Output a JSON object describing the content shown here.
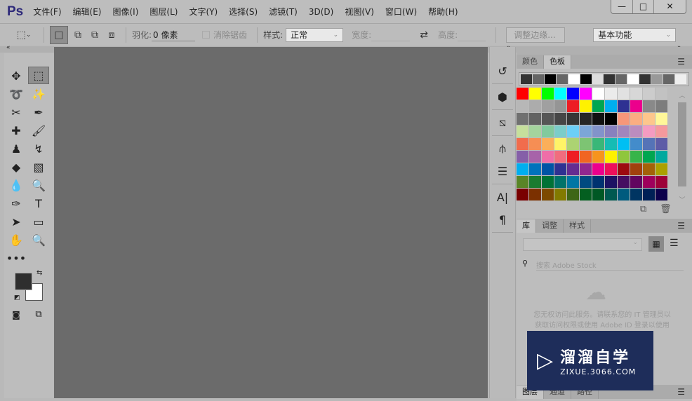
{
  "app": {
    "logo": "Ps"
  },
  "menu": [
    "文件(F)",
    "编辑(E)",
    "图像(I)",
    "图层(L)",
    "文字(Y)",
    "选择(S)",
    "滤镜(T)",
    "3D(D)",
    "视图(V)",
    "窗口(W)",
    "帮助(H)"
  ],
  "window": {
    "minimize": "—",
    "maximize": "□",
    "close": "✕"
  },
  "options": {
    "feather_label": "羽化:",
    "feather_value": "0 像素",
    "antialias": "消除锯齿",
    "style_label": "样式:",
    "style_value": "正常",
    "width_label": "宽度:",
    "height_label": "高度:",
    "refine_edge": "调整边缘...",
    "workspace": "基本功能"
  },
  "swatches_panel": {
    "tabs": [
      "颜色",
      "色板"
    ],
    "active": "色板",
    "recent": [
      "#333333",
      "#666666",
      "#000000",
      "#666666",
      "#ffffff",
      "#000000",
      "#dddddd",
      "#333333",
      "#666666",
      "#ffffff",
      "#333333",
      "#999999",
      "#666666",
      "#eeeeee"
    ],
    "colors": [
      "#ff0000",
      "#ffff00",
      "#00ff00",
      "#00ffff",
      "#0000ff",
      "#ff00ff",
      "#ffffff",
      "#ebebeb",
      "#e1e1e1",
      "#d7d7d7",
      "#cccccc",
      "#c2c2c2",
      "#b7b7b7",
      "#acacac",
      "#a0a0a0",
      "#959595",
      "#ed1c24",
      "#fff200",
      "#00a651",
      "#00aeef",
      "#2e3192",
      "#ec008c",
      "#898989",
      "#7d7d7d",
      "#707070",
      "#626262",
      "#555555",
      "#464646",
      "#363636",
      "#262626",
      "#111111",
      "#000000",
      "#f7977a",
      "#fbad82",
      "#fdc68c",
      "#fff799",
      "#c6df9c",
      "#a4d49d",
      "#81ca9d",
      "#7bcdc9",
      "#6ccff7",
      "#7ca6d8",
      "#8293ca",
      "#8881be",
      "#a286bd",
      "#bc8cbf",
      "#f49bc1",
      "#f5999d",
      "#f16c4d",
      "#f68e54",
      "#fbaf5a",
      "#fff467",
      "#acd372",
      "#7dc473",
      "#39b778",
      "#16bcb4",
      "#00bff3",
      "#438ccb",
      "#5573b7",
      "#5e5ca7",
      "#855fa8",
      "#a763a9",
      "#ef6ea8",
      "#f16d7e",
      "#ee1d24",
      "#f16522",
      "#f7941d",
      "#fff100",
      "#8fc63d",
      "#37b44a",
      "#00a650",
      "#00a99e",
      "#00aeef",
      "#0072bc",
      "#0054a5",
      "#2f3192",
      "#652c91",
      "#91278f",
      "#ed008c",
      "#ee105a",
      "#9d0a0f",
      "#a1410d",
      "#a36209",
      "#aba000",
      "#598527",
      "#1a7b30",
      "#007236",
      "#00736a",
      "#0076a4",
      "#004a80",
      "#003370",
      "#1d1363",
      "#450e61",
      "#62055f",
      "#9e005c",
      "#9d0039",
      "#790000",
      "#7b3000",
      "#7c4900",
      "#827a00",
      "#3e6617",
      "#045f20",
      "#005824",
      "#005951",
      "#005b7e",
      "#003562",
      "#002056",
      "#0c004b"
    ]
  },
  "library_panel": {
    "tabs": [
      "库",
      "调整",
      "样式"
    ],
    "search_placeholder": "搜索 Adobe Stock",
    "message": "您无权访问此服务。请联系您的 IT 管理员以获取访问权限或使用 Adobe ID 登录以使用此服务。"
  },
  "layers_panel": {
    "tabs": [
      "图层",
      "通道",
      "路径"
    ]
  },
  "watermark": {
    "title": "溜溜自学",
    "url": "ZIXUE.3066.COM"
  }
}
